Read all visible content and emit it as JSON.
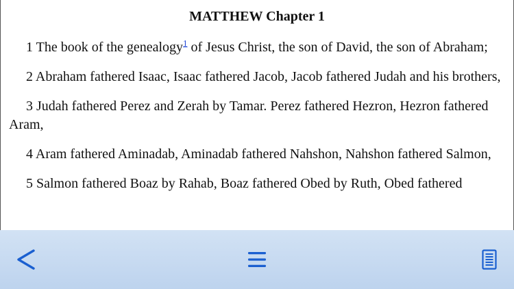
{
  "chapter": {
    "title": "MATTHEW Chapter 1"
  },
  "verses": [
    {
      "pre": "1 The book of the genealogy",
      "footnote": "1",
      "post": " of Jesus Christ, the son of David, the son of Abraham;"
    },
    {
      "text": "2 Abraham fathered Isaac, Isaac fathered Jacob, Jacob fathered Judah and his brothers,"
    },
    {
      "text": "3 Judah fathered Perez and Zerah by Tamar. Perez fathered Hezron, Hezron fathered Aram,"
    },
    {
      "text": "4 Aram fathered Aminadab, Aminadab fathered Nahshon, Nahshon fathered Salmon,"
    },
    {
      "text": "5 Salmon fathered Boaz by Rahab, Boaz fathered Obed by Ruth, Obed fathered"
    }
  ],
  "toolbar": {
    "back_icon": "chevron-left-icon",
    "menu_icon": "menu-icon",
    "notes_icon": "document-icon",
    "icon_color": "#1a5fd0",
    "background": "#c6daf1"
  }
}
